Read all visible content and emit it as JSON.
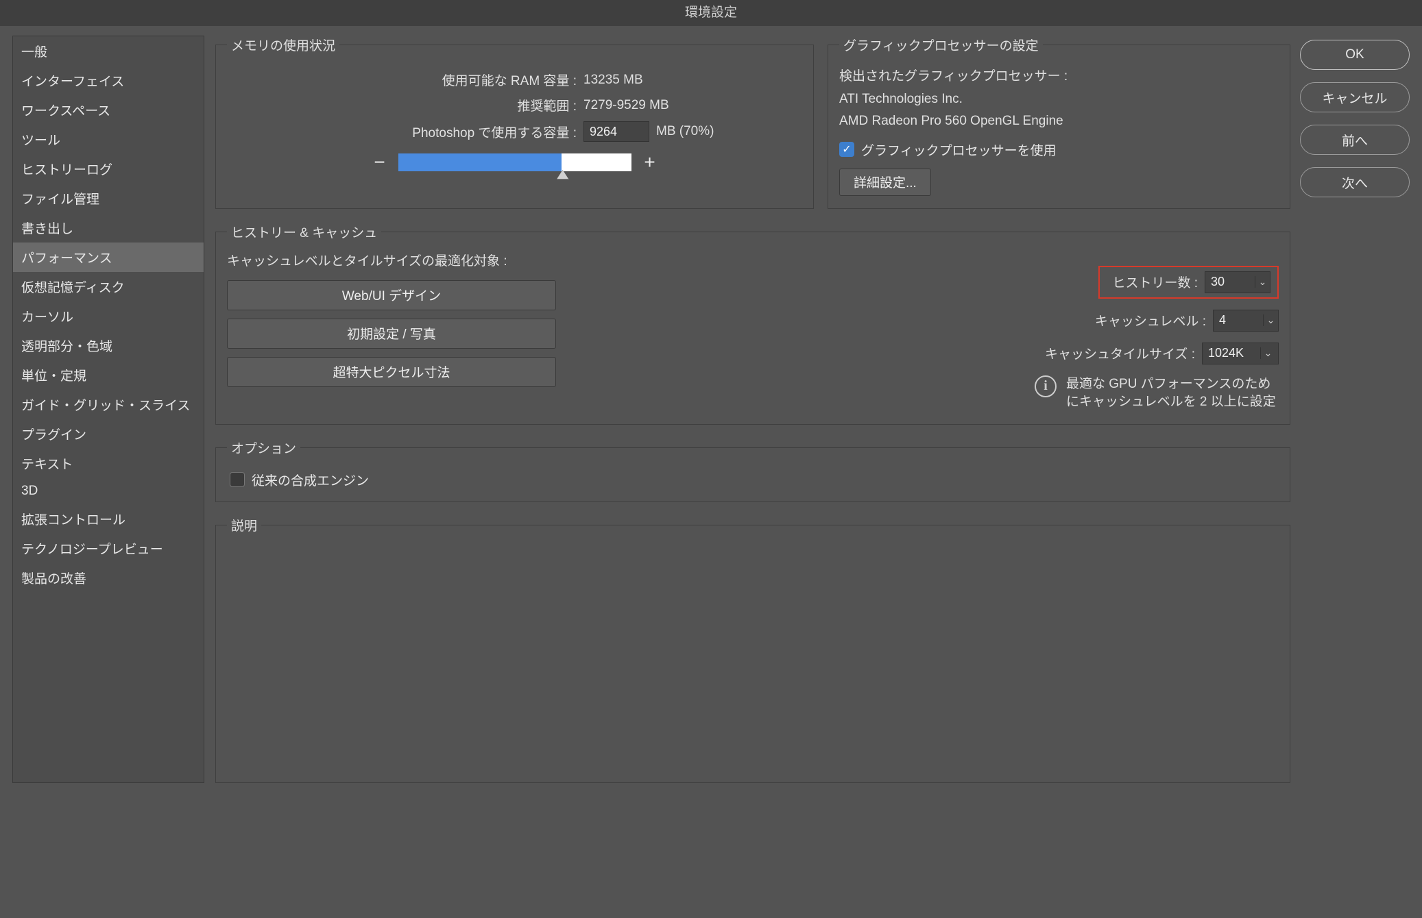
{
  "title": "環境設定",
  "sidebar": {
    "items": [
      {
        "label": "一般"
      },
      {
        "label": "インターフェイス"
      },
      {
        "label": "ワークスペース"
      },
      {
        "label": "ツール"
      },
      {
        "label": "ヒストリーログ"
      },
      {
        "label": "ファイル管理"
      },
      {
        "label": "書き出し"
      },
      {
        "label": "パフォーマンス",
        "selected": true
      },
      {
        "label": "仮想記憶ディスク"
      },
      {
        "label": "カーソル"
      },
      {
        "label": "透明部分・色域"
      },
      {
        "label": "単位・定規"
      },
      {
        "label": "ガイド・グリッド・スライス"
      },
      {
        "label": "プラグイン"
      },
      {
        "label": "テキスト"
      },
      {
        "label": "3D"
      },
      {
        "label": "拡張コントロール"
      },
      {
        "label": "テクノロジープレビュー"
      },
      {
        "label": "製品の改善"
      }
    ]
  },
  "buttons": {
    "ok": "OK",
    "cancel": "キャンセル",
    "prev": "前へ",
    "next": "次へ"
  },
  "memory": {
    "legend": "メモリの使用状況",
    "available_label": "使用可能な RAM 容量 :",
    "available_value": "13235 MB",
    "range_label": "推奨範囲 :",
    "range_value": "7279-9529 MB",
    "use_label": "Photoshop で使用する容量 :",
    "use_value": "9264",
    "use_suffix": "MB (70%)",
    "slider_percent": 70
  },
  "gpu": {
    "legend": "グラフィックプロセッサーの設定",
    "detected_label": "検出されたグラフィックプロセッサー :",
    "vendor": "ATI Technologies Inc.",
    "device": "AMD Radeon Pro 560 OpenGL Engine",
    "use_gpu_label": "グラフィックプロセッサーを使用",
    "use_gpu_checked": true,
    "advanced_btn": "詳細設定..."
  },
  "history_cache": {
    "legend": "ヒストリー & キャッシュ",
    "opt_label": "キャッシュレベルとタイルサイズの最適化対象 :",
    "preset_web": "Web/UI デザイン",
    "preset_default": "初期設定 / 写真",
    "preset_huge": "超特大ピクセル寸法",
    "history_label": "ヒストリー数 :",
    "history_value": "30",
    "cache_level_label": "キャッシュレベル :",
    "cache_level_value": "4",
    "tile_label": "キャッシュタイルサイズ :",
    "tile_value": "1024K",
    "info_text": "最適な GPU パフォーマンスのためにキャッシュレベルを 2 以上に設定"
  },
  "options": {
    "legend": "オプション",
    "legacy_label": "従来の合成エンジン",
    "legacy_checked": false
  },
  "description": {
    "legend": "説明"
  }
}
